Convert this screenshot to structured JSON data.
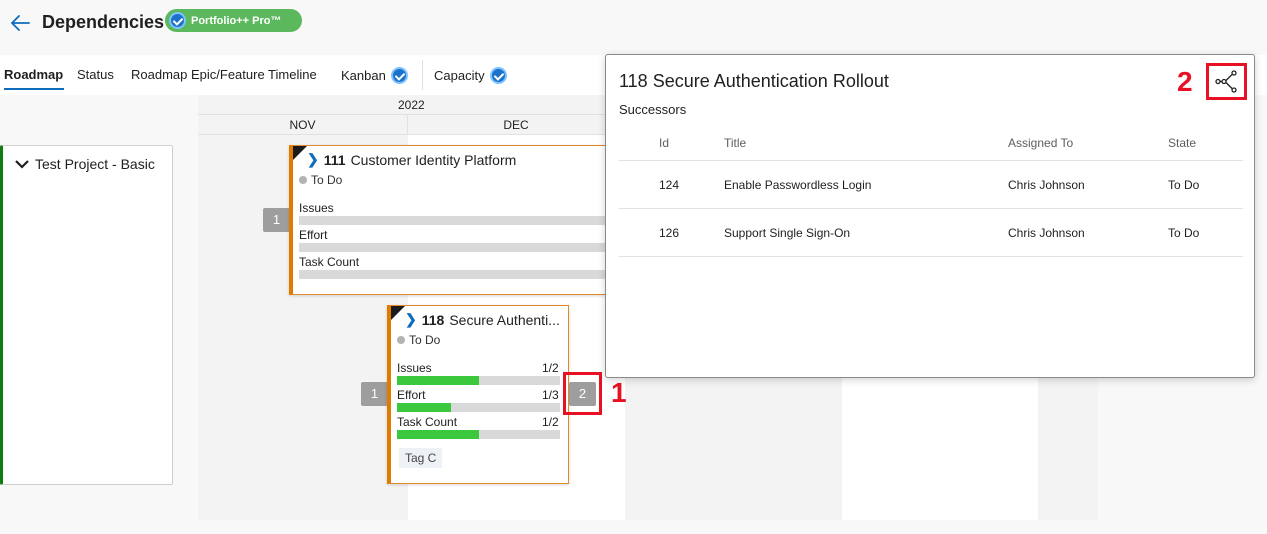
{
  "header": {
    "title": "Dependencies",
    "badge": "Portfolio++ Pro™"
  },
  "tabs": [
    {
      "label": "Roadmap",
      "active": true,
      "verified": false
    },
    {
      "label": "Status",
      "active": false,
      "verified": false
    },
    {
      "label": "Roadmap Epic/Feature Timeline",
      "active": false,
      "verified": false
    },
    {
      "label": "Kanban",
      "active": false,
      "verified": true
    },
    {
      "label": "Capacity",
      "active": false,
      "verified": true
    }
  ],
  "timeline": {
    "year": "2022",
    "months": [
      "NOV",
      "DEC"
    ]
  },
  "project": {
    "name": "Test Project - Basic"
  },
  "cards": [
    {
      "id": "111",
      "title": "Customer Identity Platform",
      "state": "To Do",
      "metrics": [
        {
          "label": "Issues",
          "value": "",
          "fill": 0
        },
        {
          "label": "Effort",
          "value": "",
          "fill": 0
        },
        {
          "label": "Task Count",
          "value": "",
          "fill": 0
        }
      ],
      "pred_count": "1"
    },
    {
      "id": "118",
      "title": "Secure Authenti...",
      "state": "To Do",
      "metrics": [
        {
          "label": "Issues",
          "value": "1/2",
          "fill": 0.5
        },
        {
          "label": "Effort",
          "value": "1/3",
          "fill": 0.333
        },
        {
          "label": "Task Count",
          "value": "1/2",
          "fill": 0.5
        }
      ],
      "tag": "Tag C",
      "pred_count": "1",
      "succ_count": "2"
    }
  ],
  "callouts": {
    "first": "1",
    "second": "2"
  },
  "panel": {
    "title": "118 Secure Authentication Rollout",
    "subtitle": "Successors",
    "columns": {
      "id": "Id",
      "title": "Title",
      "assigned": "Assigned To",
      "state": "State"
    },
    "rows": [
      {
        "id": "124",
        "title": "Enable Passwordless Login",
        "assigned": "Chris Johnson",
        "state": "To Do"
      },
      {
        "id": "126",
        "title": "Support Single Sign-On",
        "assigned": "Chris Johnson",
        "state": "To Do"
      }
    ],
    "graph_icon": "dependency-graph-icon"
  },
  "colors": {
    "accent": "#0f6cbd",
    "card_border": "#e07b00",
    "project_border": "#107c10",
    "progress": "#3cc83c",
    "highlight": "#e81123",
    "badge_bg": "#5cb85c"
  }
}
